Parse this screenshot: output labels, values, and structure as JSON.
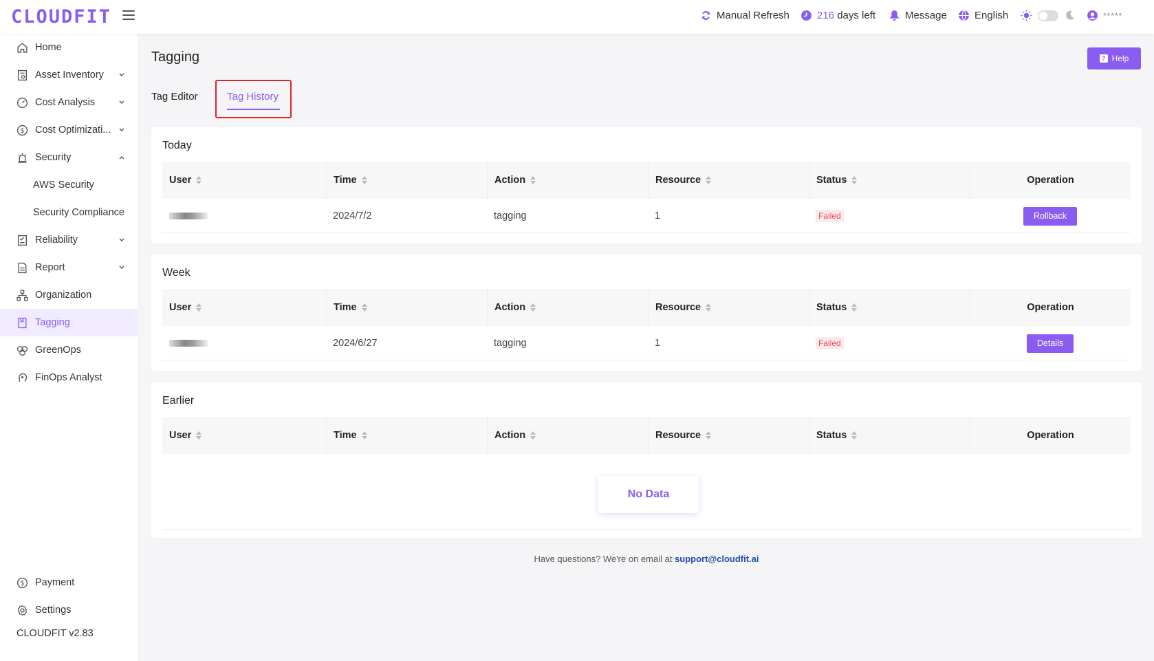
{
  "brand": {
    "logo": "CLOUDFIT",
    "accent_color": "#8a5cf0"
  },
  "header": {
    "manual_refresh": "Manual Refresh",
    "days_left_number": "216",
    "days_left_label": "days left",
    "message": "Message",
    "language": "English",
    "theme_toggle": "off",
    "user_name": "*****"
  },
  "sidebar": {
    "items": [
      {
        "label": "Home",
        "icon": "home-icon"
      },
      {
        "label": "Asset Inventory",
        "icon": "inventory-icon",
        "expandable": true
      },
      {
        "label": "Cost Analysis",
        "icon": "dashboard-icon",
        "expandable": true
      },
      {
        "label": "Cost Optimizati...",
        "icon": "dollar-icon",
        "expandable": true
      },
      {
        "label": "Security",
        "icon": "alarm-icon",
        "expandable": true,
        "expanded": true
      },
      {
        "label": "AWS Security",
        "sub": true
      },
      {
        "label": "Security Compliance",
        "sub": true
      },
      {
        "label": "Reliability",
        "icon": "checklist-icon",
        "expandable": true
      },
      {
        "label": "Report",
        "icon": "document-icon",
        "expandable": true
      },
      {
        "label": "Organization",
        "icon": "org-chart-icon"
      },
      {
        "label": "Tagging",
        "icon": "bookmark-icon",
        "active": true
      },
      {
        "label": "GreenOps",
        "icon": "leaf-icon"
      },
      {
        "label": "FinOps Analyst",
        "icon": "brain-icon"
      }
    ],
    "bottom": [
      {
        "label": "Payment",
        "icon": "dollar-icon"
      },
      {
        "label": "Settings",
        "icon": "gear-icon"
      }
    ],
    "version": "CLOUDFIT v2.83"
  },
  "main": {
    "title": "Tagging",
    "help_label": "Help",
    "tabs": [
      {
        "label": "Tag Editor",
        "active": false
      },
      {
        "label": "Tag History",
        "active": true
      }
    ],
    "columns": [
      "User",
      "Time",
      "Action",
      "Resource",
      "Status",
      "Operation"
    ],
    "sections": [
      {
        "title": "Today",
        "rows": [
          {
            "user": "*****",
            "time": "2024/7/2",
            "action": "tagging",
            "resource": "1",
            "status": "Failed",
            "operation": "Rollback"
          }
        ]
      },
      {
        "title": "Week",
        "rows": [
          {
            "user": "*****",
            "time": "2024/6/27",
            "action": "tagging",
            "resource": "1",
            "status": "Failed",
            "operation": "Details"
          }
        ]
      },
      {
        "title": "Earlier",
        "rows": [],
        "empty_text": "No Data"
      }
    ]
  },
  "footer": {
    "text": "Have questions? We're on email at",
    "email": "support@cloudfit.ai"
  }
}
